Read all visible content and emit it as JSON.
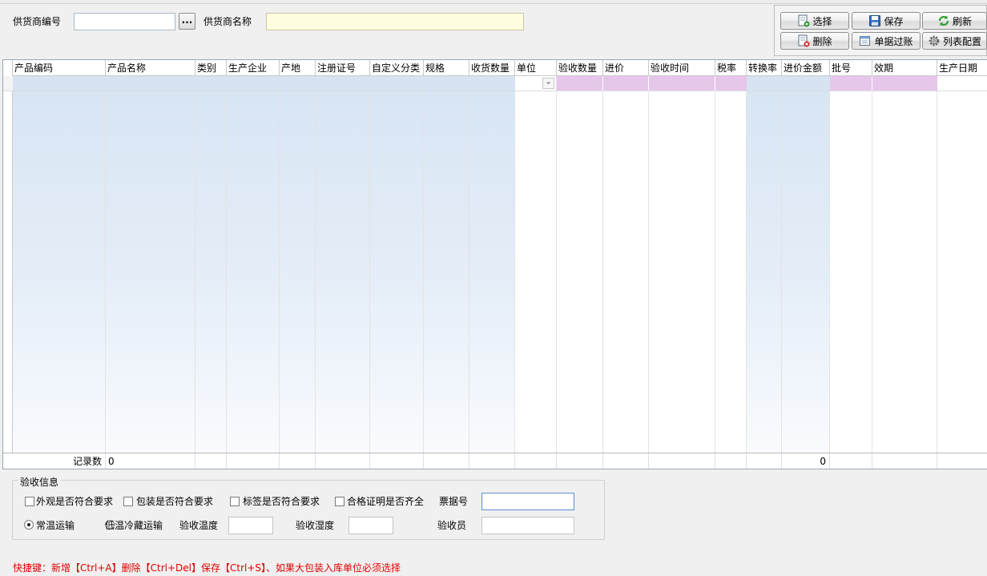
{
  "header": {
    "supplier_code_label": "供货商编号",
    "supplier_code_value": "",
    "browse_label": "...",
    "supplier_name_label": "供货商名称",
    "supplier_name_value": ""
  },
  "toolbar": {
    "select": "选择",
    "save": "保存",
    "refresh": "刷新",
    "delete": "删除",
    "post": "单据过账",
    "column_config": "列表配置"
  },
  "grid": {
    "columns": [
      "产品编码",
      "产品名称",
      "类别",
      "生产企业",
      "产地",
      "注册证号",
      "自定义分类",
      "规格",
      "收货数量",
      "单位",
      "验收数量",
      "进价",
      "验收时间",
      "税率",
      "转换率",
      "进价金额",
      "批号",
      "效期",
      "生产日期"
    ],
    "footer": {
      "record_count_label": "记录数",
      "record_count_value": "0",
      "amount_total": "0"
    }
  },
  "acceptance": {
    "group_title": "验收信息",
    "check_appearance": "外观是否符合要求",
    "check_packaging": "包装是否符合要求",
    "check_label": "标签是否符合要求",
    "check_certificate": "合格证明是否齐全",
    "invoice_no_label": "票据号",
    "invoice_no_value": "",
    "radio_normal": "常温运输",
    "radio_cold": "低温冷藏运输",
    "temperature_label": "验收温度",
    "humidity_label": "验收湿度",
    "inspector_label": "验收员",
    "selected_transport": "常温运输"
  },
  "shortcut_hint": "快捷键：新增【Ctrl+A】删除【Ctrl+Del】保存【Ctrl+S】、如果大包装入库单位必须选择",
  "colors": {
    "readonly_column": "#d6e4f3",
    "editable_cell": "#e6c6ea",
    "supplier_name_bg": "#fffde0",
    "hint_text": "#e00000"
  }
}
